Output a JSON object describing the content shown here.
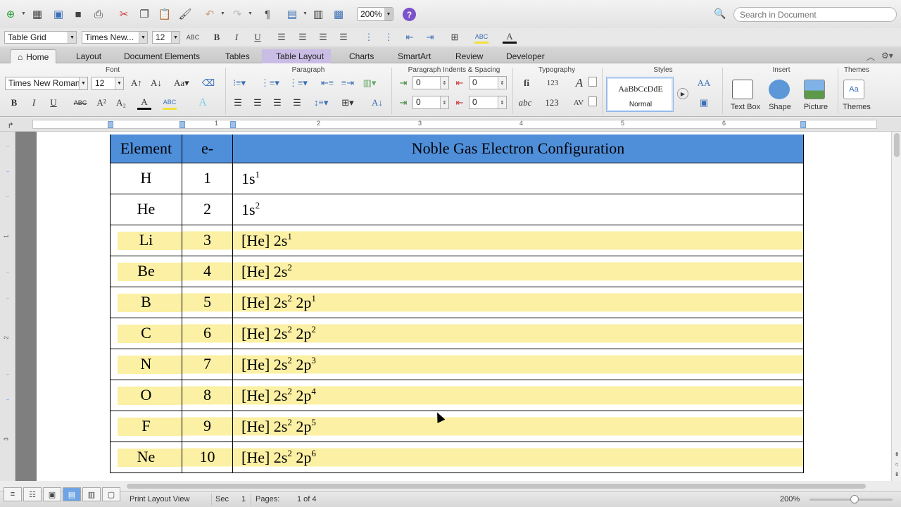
{
  "toolbar": {
    "zoom": "200%",
    "help": "?",
    "search_placeholder": "Search in Document"
  },
  "format_row": {
    "style": "Table Grid",
    "font": "Times New...",
    "size": "12",
    "abc": "ABC",
    "bold": "B",
    "italic": "I",
    "underline": "U",
    "font_color": "A"
  },
  "tabs": [
    "Home",
    "Layout",
    "Document Elements",
    "Tables",
    "Table Layout",
    "Charts",
    "SmartArt",
    "Review",
    "Developer"
  ],
  "ribbon": {
    "font_group": "Font",
    "font_name": "Times New Roman",
    "font_size": "12",
    "paragraph_group": "Paragraph",
    "indents_group": "Paragraph Indents & Spacing",
    "indent_left": "0",
    "indent_right": "0",
    "space_before": "0",
    "space_after": "0",
    "typography_group": "Typography",
    "styles_group": "Styles",
    "style_sample": "AaBbCcDdE",
    "style_name": "Normal",
    "insert_group": "Insert",
    "textbox": "Text Box",
    "shape": "Shape",
    "picture": "Picture",
    "themes_group": "Themes",
    "themes": "Themes",
    "fmt_b": "B",
    "fmt_i": "I",
    "fmt_u": "U",
    "fmt_abc": "ABC",
    "fmt_sup": "A²",
    "fmt_sub": "A₂",
    "fmt_color": "A",
    "fmt_hl": "ABC",
    "fmt_fx": "A",
    "typo_fi": "fi",
    "typo_123": "123",
    "typo_abc": "abc",
    "typo_123b": "123",
    "typo_av": "AV",
    "themes_aa": "Aa",
    "style_aa": "AA"
  },
  "ruler": {
    "numbers": [
      "1",
      "2",
      "3",
      "4",
      "5",
      "6"
    ],
    "v_numbers": [
      "1",
      "2",
      "3"
    ]
  },
  "table": {
    "headers": [
      "Element",
      "e-",
      "Noble Gas Electron Configuration"
    ],
    "rows": [
      {
        "el": "H",
        "e": "1",
        "base": "1s",
        "s": "1",
        "p": "",
        "hl": false
      },
      {
        "el": "He",
        "e": "2",
        "base": "1s",
        "s": "2",
        "p": "",
        "hl": false
      },
      {
        "el": "Li",
        "e": "3",
        "base": "[He] 2s",
        "s": "1",
        "p": "",
        "hl": true
      },
      {
        "el": "Be",
        "e": "4",
        "base": "[He] 2s",
        "s": "2",
        "p": "",
        "hl": true
      },
      {
        "el": "B",
        "e": "5",
        "base": "[He] 2s",
        "s": "2",
        "p": "1",
        "hl": true
      },
      {
        "el": "C",
        "e": "6",
        "base": "[He] 2s",
        "s": "2",
        "p": "2",
        "hl": true
      },
      {
        "el": "N",
        "e": "7",
        "base": "[He] 2s",
        "s": "2",
        "p": "3",
        "hl": true
      },
      {
        "el": "O",
        "e": "8",
        "base": "[He] 2s",
        "s": "2",
        "p": "4",
        "hl": true
      },
      {
        "el": "F",
        "e": "9",
        "base": "[He] 2s",
        "s": "2",
        "p": "5",
        "hl": true
      },
      {
        "el": "Ne",
        "e": "10",
        "base": "[He] 2s",
        "s": "2",
        "p": "6",
        "hl": true
      }
    ],
    "p_label": " 2p"
  },
  "status": {
    "view": "Print Layout View",
    "sec_label": "Sec",
    "sec": "1",
    "pages_label": "Pages:",
    "pages": "1 of 4",
    "zoom": "200%"
  },
  "colors": {
    "header_blue": "#4f8fda",
    "highlight_yellow": "#fbf0a3"
  }
}
